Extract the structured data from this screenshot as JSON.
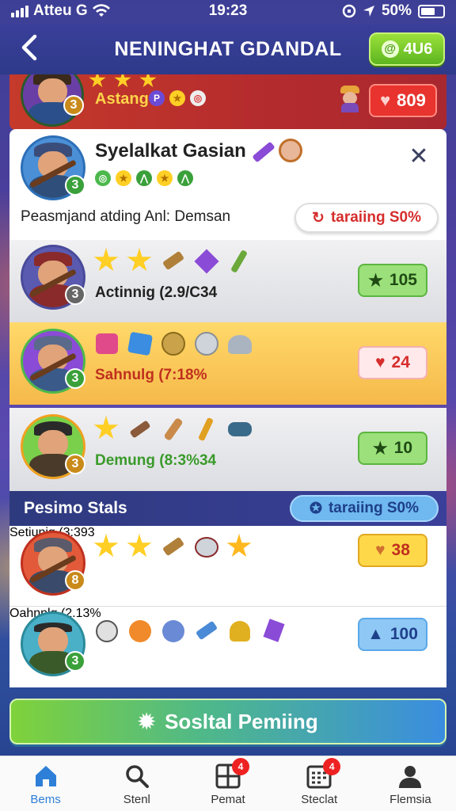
{
  "status_bar": {
    "carrier": "Attеu G",
    "time": "19:23",
    "battery": "50%"
  },
  "header": {
    "title": "NENINGHAT GDANDAL",
    "coins": "4U6"
  },
  "top_card": {
    "name": "Astang",
    "level": "3",
    "score": "809"
  },
  "detail": {
    "name": "Syelalkat Gasian",
    "level": "3",
    "description": "Peasmjand atding Anl: Demsan",
    "rating_pill": "taraiing S0%"
  },
  "rows": [
    {
      "label": "Actinnig (2.9/C34",
      "level": "3",
      "score": "105"
    },
    {
      "label": "Sahnulg (7:18%",
      "level": "3",
      "score": "24"
    },
    {
      "label": "Demung (8:3%34",
      "level": "3",
      "score": "10"
    }
  ],
  "section": {
    "title": "Pesimo Stals",
    "pill": "taraiing S0%"
  },
  "section_rows": [
    {
      "label": "Setiunig (3:393",
      "level": "8",
      "score": "38"
    },
    {
      "label": "Oahnnlg (2.13%",
      "level": "3",
      "score": "100"
    }
  ],
  "cta": {
    "label": "Sosltal Pemiing"
  },
  "nav": [
    {
      "label": "Bems",
      "icon": "home-icon"
    },
    {
      "label": "Stenl",
      "icon": "search-icon"
    },
    {
      "label": "Pemat",
      "icon": "grid-icon",
      "badge": "4"
    },
    {
      "label": "Steclat",
      "icon": "calendar-icon",
      "badge": "4"
    },
    {
      "label": "Flemsia",
      "icon": "profile-icon"
    }
  ],
  "colors": {
    "accent": "#2e7fd8",
    "green": "#8ad33a",
    "red": "#e53935",
    "gold": "#f5c64a"
  }
}
